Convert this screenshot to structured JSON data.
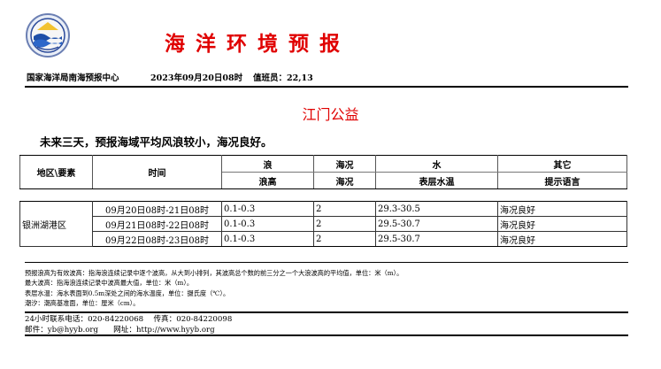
{
  "header": {
    "title": "海洋环境预报",
    "issuer": "国家海洋局南海预报中心",
    "issue_time": "2023年09月20日08时",
    "duty_officer": "值班员：22,13",
    "logo_icon": "soa-emblem-icon"
  },
  "region_name": "江门公益",
  "summary": "未来三天，预报海域平均风浪较小，海况良好。",
  "table": {
    "headers_top": [
      "地区\\要素",
      "时间",
      "浪",
      "海况",
      "水",
      "其它"
    ],
    "headers_bottom": [
      "浪高",
      "海况",
      "表层水温",
      "提示语言"
    ],
    "area": "银洲湖港区",
    "rows": [
      {
        "time": "09月20日08时-21日08时",
        "wave": "0.1-0.3",
        "sea_state": "2",
        "water_temp": "29.3-30.5",
        "tip": "海况良好"
      },
      {
        "time": "09月21日08时-22日08时",
        "wave": "0.1-0.3",
        "sea_state": "2",
        "water_temp": "29.5-30.7",
        "tip": "海况良好"
      },
      {
        "time": "09月22日08时-23日08时",
        "wave": "0.1-0.3",
        "sea_state": "2",
        "water_temp": "29.5-30.7",
        "tip": "海况良好"
      }
    ]
  },
  "notes": [
    "预报浪高为有效波高：指海浪连续记录中逐个波高，从大到小排列，其波高总个数的前三分之一个大浪波高的平均值，单位：米（m）。",
    "最大波高：指海浪连续记录中波高最大值，单位：米（m）。",
    "表层水温：海水表面到0.5m深处之间的海水温度，单位：摄氏度（℃）。",
    "潮汐：潮高基准面，单位：厘米（cm）。"
  ],
  "contact": {
    "line1": "24小时联系电话：020-84220068　 传真：020-84220098",
    "line2": "邮件：yb@hyyb.org　　网址：http://www.hyyb.org"
  }
}
